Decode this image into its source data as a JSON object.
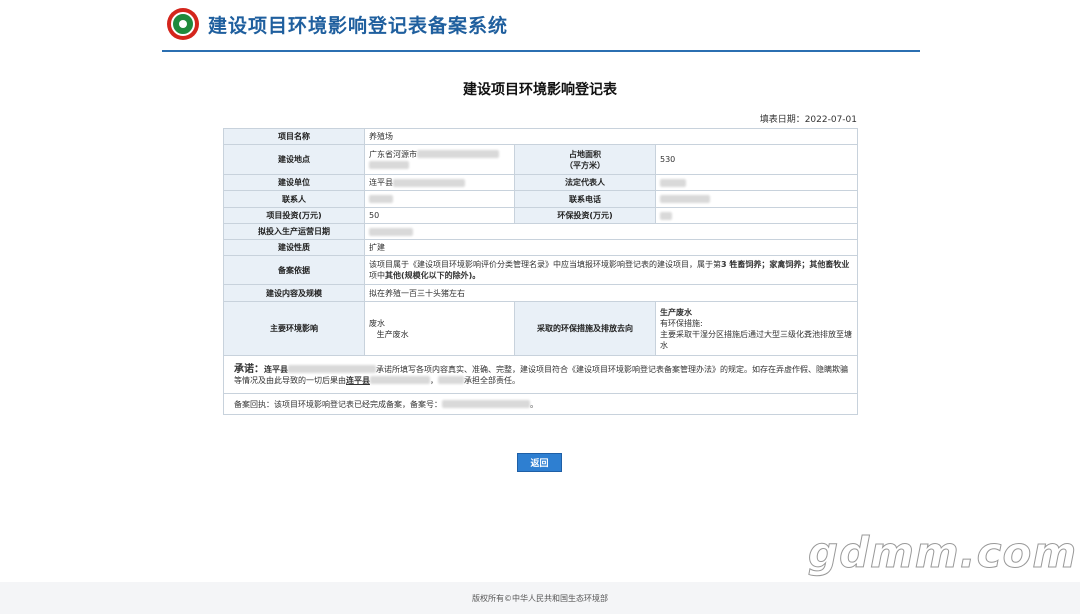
{
  "header": {
    "title": "建设项目环境影响登记表备案系统"
  },
  "form": {
    "title": "建设项目环境影响登记表",
    "fill_date": "填表日期：2022-07-01",
    "rows": {
      "project_name_label": "项目名称",
      "project_name_value": "养殖场",
      "location_label": "建设地点",
      "location_value": "广东省河源市",
      "area_label": "占地面积",
      "area_unit": "（平方米）",
      "area_value": "530",
      "unit_label": "建设单位",
      "unit_value": "连平县",
      "legal_rep_label": "法定代表人",
      "contact_label": "联系人",
      "phone_label": "联系电话",
      "investment_label": "项目投资(万元)",
      "investment_value": "50",
      "env_investment_label": "环保投资(万元)",
      "start_date_label": "拟投入生产运营日期",
      "nature_label": "建设性质",
      "nature_value": "扩建",
      "basis_label": "备案依据",
      "basis_text_1": "该项目属于《建设项目环境影响评价分类管理名录》中应当填报环境影响登记表的建设项目，属于第",
      "basis_bold_1": "3 牲畜饲养；家禽饲养；其他畜牧业",
      "basis_text_2": "项中",
      "basis_bold_2": "其他(规模化以下的除外)。",
      "content_label": "建设内容及规模",
      "content_value": "拟在养殖一百三十头猪左右",
      "impact_label": "主要环境影响",
      "impact_1": "废水",
      "impact_2": "生产废水",
      "measures_label": "采取的环保措施及排放去向",
      "measures_title": "生产废水",
      "measures_1": "有环保措施:",
      "measures_2": "主要采取干湿分区措施后通过大型三级化粪池排放至塘水"
    },
    "promise": {
      "title": "承诺：",
      "name_prefix": "连平县",
      "text_1": "承诺所填写各项内容真实、准确、完整，建设项目符合《建设项目环境影响登记表备案管理办法》的规定。如存在弄虚作假、隐瞒欺骗等情况及由此导致的一切后果由",
      "name_2": "连平县",
      "text_2": "承担全部责任。"
    },
    "receipt": {
      "text": "备案回执：该项目环境影响登记表已经完成备案，备案号：",
      "end": "。"
    }
  },
  "buttons": {
    "back_label": "返回"
  },
  "footer": {
    "copyright": "版权所有©中华人民共和国生态环境部"
  },
  "watermark": {
    "text": "gdmm.com"
  },
  "colors": {
    "accent": "#2b6fb1",
    "button": "#2e7fd1",
    "label_bg": "#e9f0f7",
    "title": "#1f5f9e"
  }
}
